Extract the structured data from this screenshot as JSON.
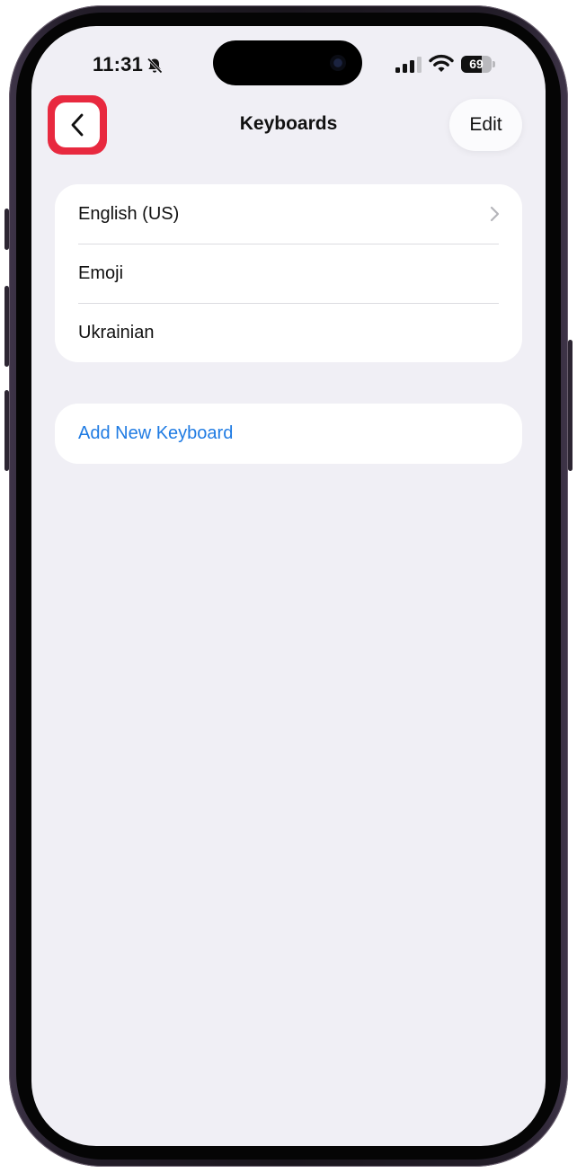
{
  "status_bar": {
    "time": "11:31",
    "silent_icon": "bell-slash-icon",
    "signal_icon": "cellular-signal-icon",
    "wifi_icon": "wifi-icon",
    "battery_level": 69,
    "battery_text": "69"
  },
  "nav": {
    "back_icon": "chevron-left-icon",
    "title": "Keyboards",
    "edit_label": "Edit",
    "highlight_color": "#e8293f"
  },
  "keyboards": {
    "items": [
      {
        "label": "English (US)",
        "has_chevron": true
      },
      {
        "label": "Emoji",
        "has_chevron": false
      },
      {
        "label": "Ukrainian",
        "has_chevron": false
      }
    ]
  },
  "add_keyboard": {
    "label": "Add New Keyboard",
    "color": "#1f7be3"
  }
}
